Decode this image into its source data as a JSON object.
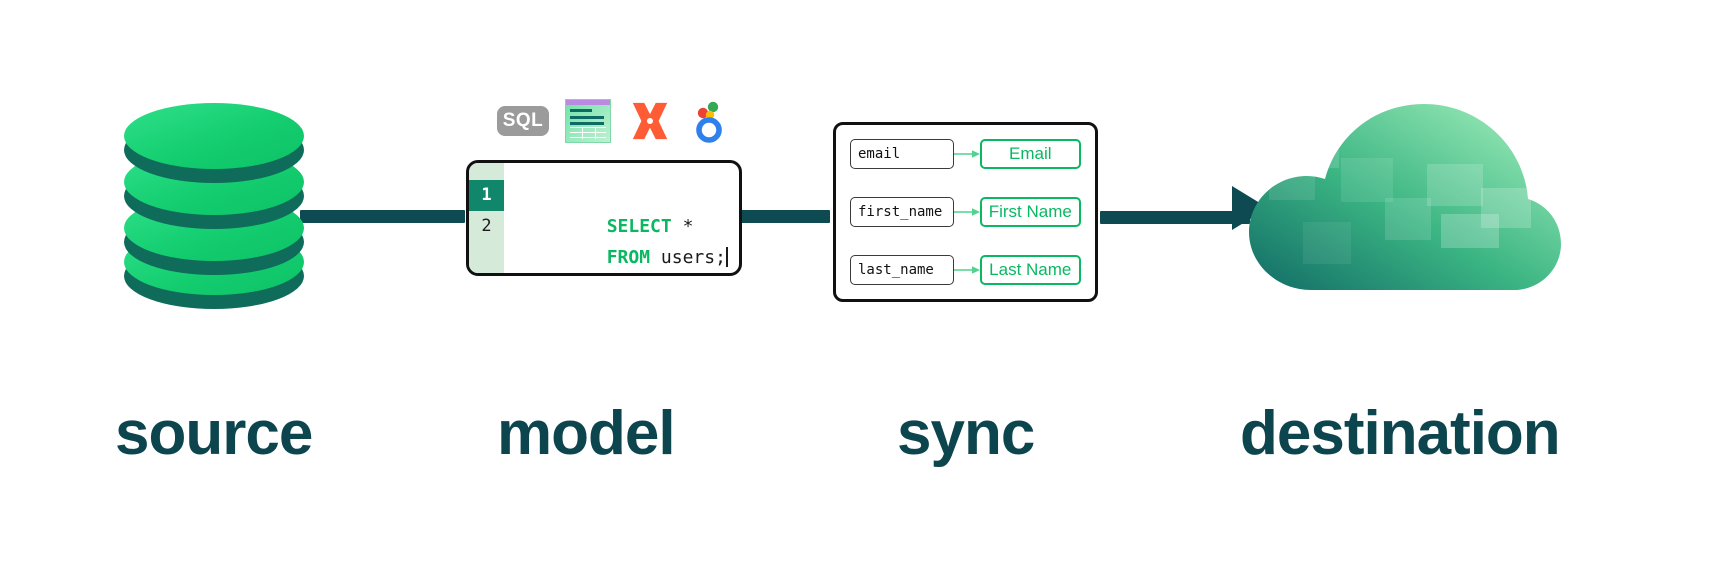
{
  "diagram": {
    "title": "data pipeline flow",
    "stages": [
      {
        "id": "source",
        "caption": "source"
      },
      {
        "id": "model",
        "caption": "model"
      },
      {
        "id": "sync",
        "caption": "sync"
      },
      {
        "id": "destination",
        "caption": "destination"
      }
    ]
  },
  "source": {
    "icon_name": "database-cylinder-icon",
    "disc_count": 4
  },
  "model": {
    "tools": [
      {
        "name": "sql-badge-icon",
        "label": "SQL"
      },
      {
        "name": "spreadsheet-icon",
        "label": ""
      },
      {
        "name": "dbt-x-icon",
        "label": ""
      },
      {
        "name": "looker-icon",
        "label": ""
      }
    ],
    "editor": {
      "lines": [
        {
          "number": "1",
          "keyword": "SELECT",
          "rest": " *",
          "active": true
        },
        {
          "number": "2",
          "keyword": "FROM",
          "rest": " users;",
          "active": false
        }
      ]
    }
  },
  "sync": {
    "mappings": [
      {
        "source_field": "email",
        "destination_field": "Email"
      },
      {
        "source_field": "first_name",
        "destination_field": "First Name"
      },
      {
        "source_field": "last_name",
        "destination_field": "Last Name"
      }
    ]
  },
  "destination": {
    "icon_name": "cloud-icon"
  },
  "colors": {
    "dark_teal": "#0d454e",
    "connector": "#0d4a52",
    "green": "#0ab862",
    "db_green": "#12cc6e",
    "db_shadow": "#0f6b5a",
    "gutter": "#d5ead9",
    "gutter_active": "#10866b",
    "sql_badge_bg": "#9b9b9b",
    "dbt_orange": "#fd5c35",
    "looker_blue": "#2f80ed",
    "background": "#ffffff"
  }
}
